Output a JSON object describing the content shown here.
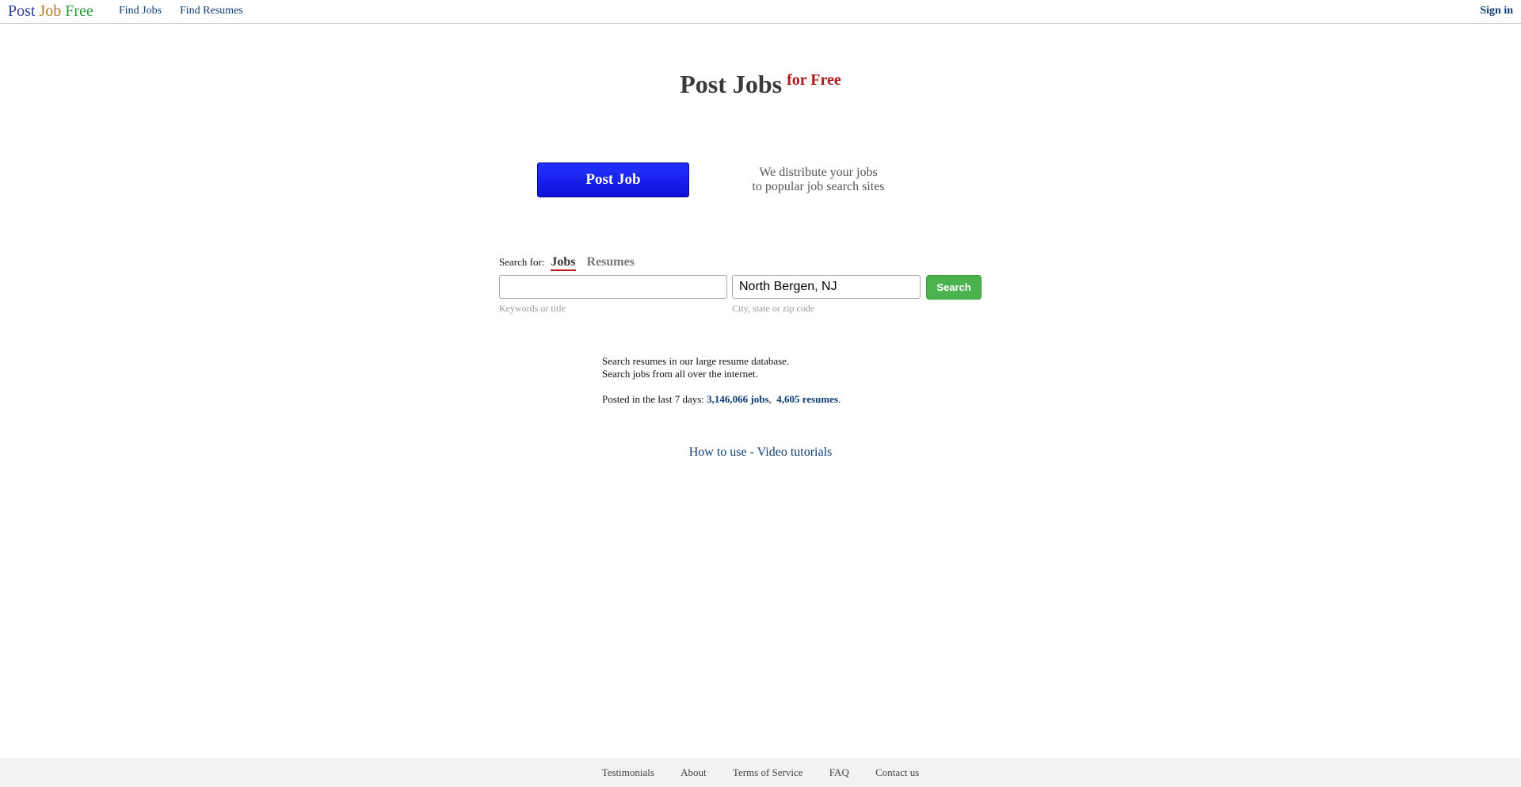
{
  "header": {
    "logo": {
      "post": "Post",
      "job": "Job",
      "free": "Free"
    },
    "nav": {
      "find_jobs": "Find Jobs",
      "find_resumes": "Find Resumes"
    },
    "sign_in": "Sign in"
  },
  "hero": {
    "title": "Post Jobs",
    "title_sup": "for Free",
    "post_job_button": "Post Job",
    "distribute_line1": "We distribute your jobs",
    "distribute_line2": "to popular job search sites"
  },
  "search": {
    "label": "Search for:",
    "tabs": [
      "Jobs",
      "Resumes"
    ],
    "active_tab": "Jobs",
    "keywords_value": "",
    "keywords_hint": "Keywords or title",
    "location_value": "North Bergen, NJ",
    "location_hint": "City, state or zip code",
    "button": "Search"
  },
  "info": {
    "line1": "Search resumes in our large resume database.",
    "line2": "Search jobs from all over the internet.",
    "posted_prefix": "Posted in the last 7 days:",
    "jobs_count": "3,146,066 jobs",
    "separator": ",",
    "resumes_count": "4,605 resumes",
    "end": "."
  },
  "tutorials": "How to use - Video tutorials",
  "footer": {
    "links": [
      "Testimonials",
      "About",
      "Terms of Service",
      "FAQ",
      "Contact us"
    ]
  },
  "colors": {
    "link": "#0d3c70",
    "post_job_button": "#1a22f0",
    "search_button": "#4cb24e",
    "accent_red": "#b01818"
  }
}
